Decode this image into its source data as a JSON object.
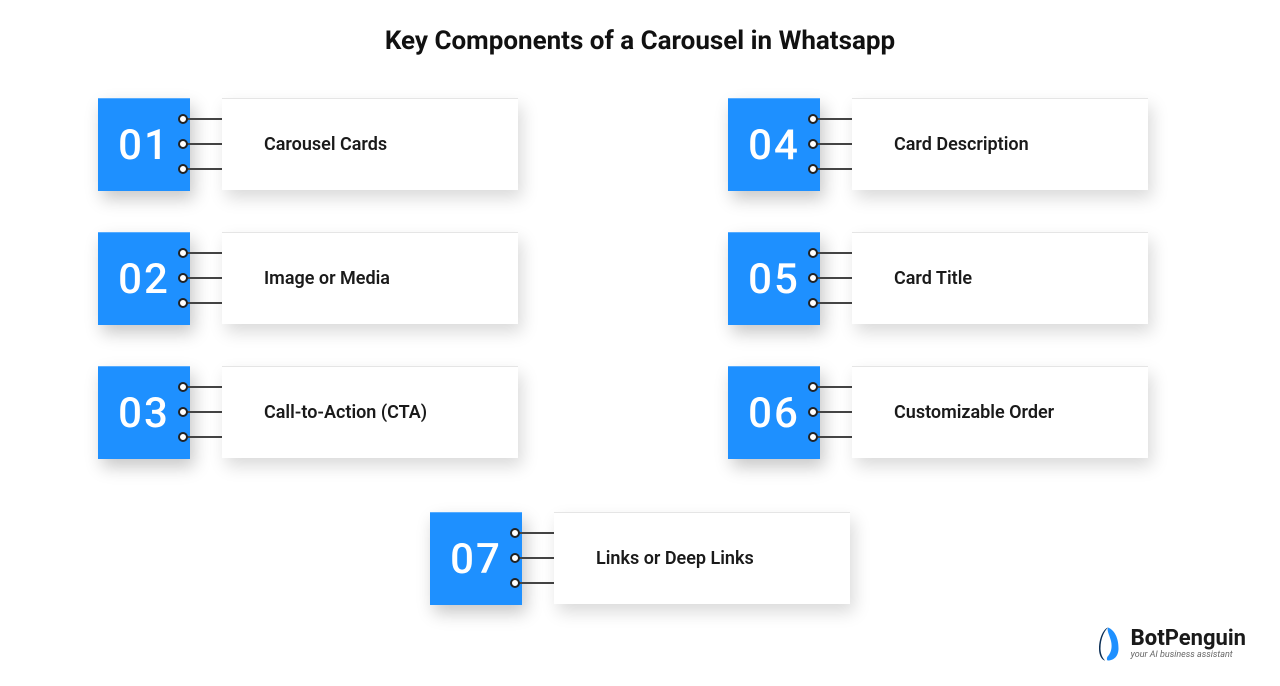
{
  "title": "Key Components of a Carousel in Whatsapp",
  "items": [
    {
      "num": "01",
      "label": "Carousel Cards"
    },
    {
      "num": "02",
      "label": "Image or Media"
    },
    {
      "num": "03",
      "label": "Call-to-Action (CTA)"
    },
    {
      "num": "04",
      "label": "Card Description"
    },
    {
      "num": "05",
      "label": "Card Title"
    },
    {
      "num": "06",
      "label": "Customizable Order"
    },
    {
      "num": "07",
      "label": "Links or Deep Links"
    }
  ],
  "brand": {
    "name_bold": "Bot",
    "name_rest": "Penguin",
    "tagline": "your AI business assistant"
  },
  "colors": {
    "accent": "#1E90FF"
  }
}
